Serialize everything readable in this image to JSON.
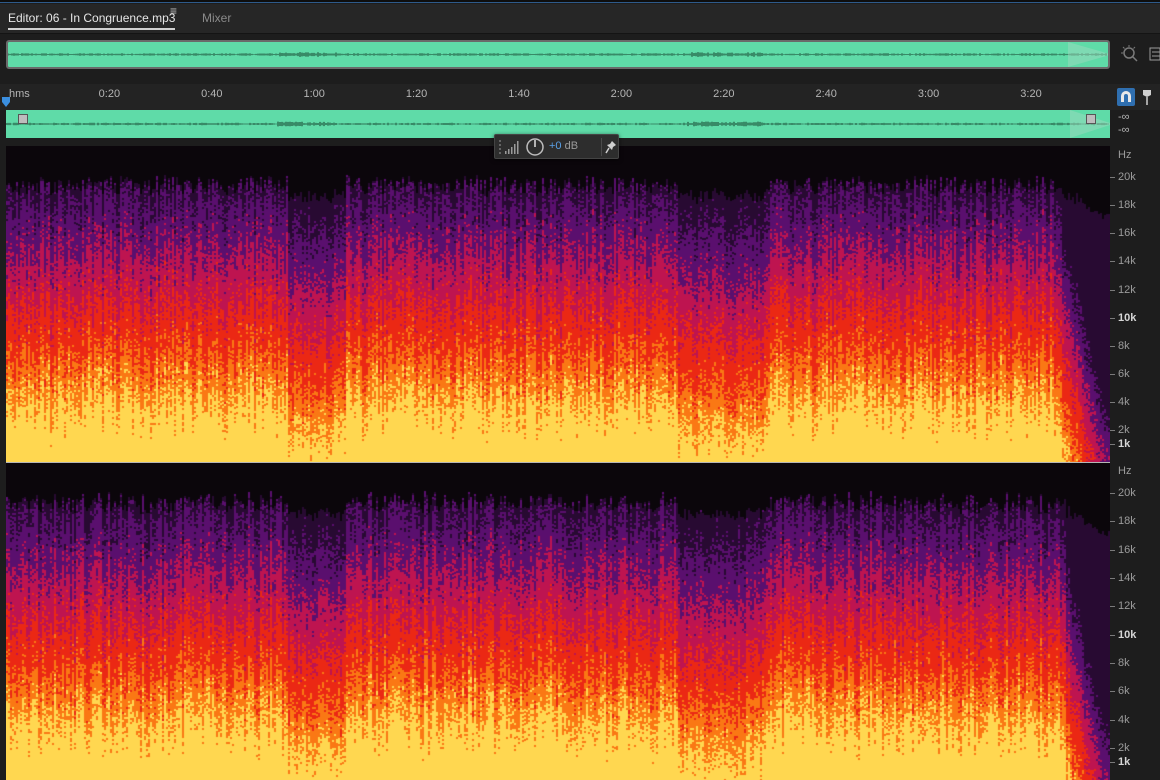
{
  "tabs": {
    "editor_label": "Editor: 06 - In Congruence.mp3",
    "menu_glyph": "≡",
    "mixer_label": "Mixer"
  },
  "ruler": {
    "unit": "hms",
    "ticks": [
      {
        "label": "0:20",
        "seconds": 20
      },
      {
        "label": "0:40",
        "seconds": 40
      },
      {
        "label": "1:00",
        "seconds": 60
      },
      {
        "label": "1:20",
        "seconds": 80
      },
      {
        "label": "1:40",
        "seconds": 100
      },
      {
        "label": "2:00",
        "seconds": 120
      },
      {
        "label": "2:20",
        "seconds": 140
      },
      {
        "label": "2:40",
        "seconds": 160
      },
      {
        "label": "3:00",
        "seconds": 180
      },
      {
        "label": "3:20",
        "seconds": 200
      }
    ]
  },
  "track": {
    "level_left": "-∞",
    "level_right": "-∞"
  },
  "hud": {
    "value": "+0",
    "unit": " dB"
  },
  "spectral": {
    "unit": "Hz",
    "labels": [
      {
        "text": "20k",
        "bold": false
      },
      {
        "text": "18k",
        "bold": false
      },
      {
        "text": "16k",
        "bold": false
      },
      {
        "text": "14k",
        "bold": false
      },
      {
        "text": "12k",
        "bold": false
      },
      {
        "text": "10k",
        "bold": true
      },
      {
        "text": "8k",
        "bold": false
      },
      {
        "text": "6k",
        "bold": false
      },
      {
        "text": "4k",
        "bold": false
      },
      {
        "text": "2k",
        "bold": false
      },
      {
        "text": "1k",
        "bold": true
      }
    ]
  },
  "colors": {
    "waveform": "#5fdba8",
    "accent": "#2f6fb0",
    "hud_value": "#5aa0e6"
  },
  "icons": [
    "zoom-icon",
    "panel-menu-icon",
    "snap-icon",
    "marker-icon",
    "playhead-icon",
    "knob-icon",
    "pin-icon"
  ]
}
